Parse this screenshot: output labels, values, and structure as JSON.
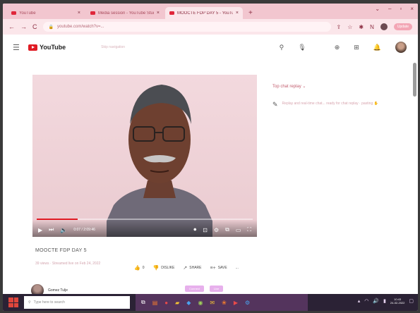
{
  "browser": {
    "tabs": [
      {
        "title": "YouTube"
      },
      {
        "title": "Media session - YouTube Studio"
      },
      {
        "title": "MOOCTE FDP DAY 5 - YouTube"
      }
    ],
    "new_tab_label": "+",
    "address": "youtube.com/watch?v=...",
    "update_label": "Update"
  },
  "youtube": {
    "logo_text": "YouTube",
    "skip_nav": "Skip navigation"
  },
  "video": {
    "current_time": "0:07 / 2:09:46",
    "progress_fraction": 0.19,
    "title": "MOOCTE FDP DAY 5",
    "meta": "39 views · Streamed live on Feb 24, 2022",
    "actions": {
      "like": "0",
      "dislike": "DISLIKE",
      "share": "SHARE",
      "save": "SAVE",
      "more": "..."
    },
    "channel_name": "Gomez Tulje"
  },
  "sidebar": {
    "heading": "Top chat replay",
    "message": "Replay and real-time chat... ready for chat replay · pasting"
  },
  "chips": [
    "Connect",
    "Live"
  ],
  "taskbar": {
    "search_placeholder": "Type here to search",
    "clock_time": "10:43",
    "clock_date": "24-02-2022"
  },
  "colors": {
    "tab_strip": "#f2c6cf",
    "youtube_red": "#e01b24",
    "taskbar": "#2b2235"
  }
}
